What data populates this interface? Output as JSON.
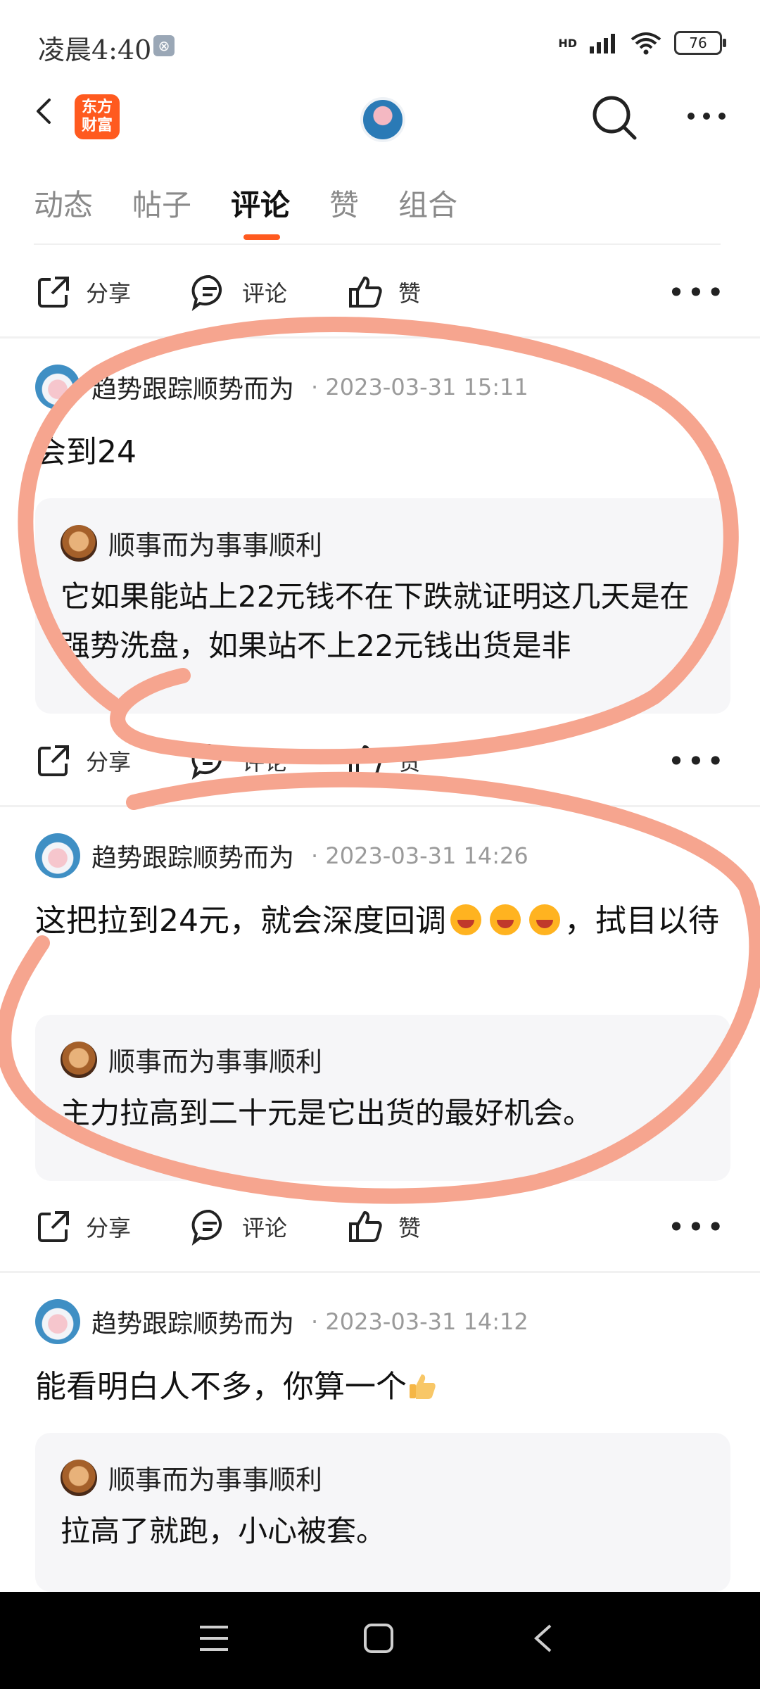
{
  "status_bar": {
    "time": "凌晨4:40",
    "network": "HD",
    "battery": "76"
  },
  "header": {
    "logo_text": "东方财富"
  },
  "tabs": [
    {
      "label": "动态"
    },
    {
      "label": "帖子"
    },
    {
      "label": "评论"
    },
    {
      "label": "赞"
    },
    {
      "label": "组合"
    }
  ],
  "actions": {
    "share": "分享",
    "comment": "评论",
    "like": "赞"
  },
  "comments": [
    {
      "user": "趋势跟踪顺势而为",
      "meta": "· 2023-03-31 15:11",
      "text": "会到24",
      "quote_user": "顺事而为事事顺利",
      "quote_text": "它如果能站上22元钱不在下跌就证明这几天是在强势洗盘，如果站不上22元钱出货是非"
    },
    {
      "user": "趋势跟踪顺势而为",
      "meta": "· 2023-03-31 14:26",
      "text_a": "这把拉到24元，就会深度回调",
      "text_b": "，拭目以待",
      "quote_user": "顺事而为事事顺利",
      "quote_text": "主力拉高到二十元是它出货的最好机会。"
    },
    {
      "user": "趋势跟踪顺势而为",
      "meta": "· 2023-03-31 14:12",
      "text": "能看明白人不多，你算一个",
      "quote_user": "顺事而为事事顺利",
      "quote_text": "拉高了就跑，小心被套。"
    }
  ],
  "colors": {
    "accent": "#ff5a1f",
    "scribble": "#f6a58f"
  }
}
